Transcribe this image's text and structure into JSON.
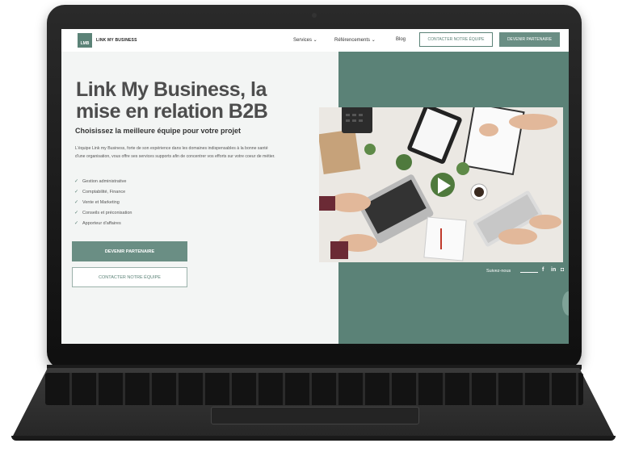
{
  "header": {
    "logo_text": "LMB",
    "brand": "LINK MY BUSINESS",
    "nav": [
      {
        "label": "Services ⌄"
      },
      {
        "label": "Référencements ⌄"
      },
      {
        "label": "Blog"
      }
    ],
    "contact_button": "CONTACTER NOTRE ÉQUIPE",
    "partner_button": "DEVENIR PARTENAIRE"
  },
  "hero": {
    "title": "Link My Business, la mise en relation B2B",
    "subtitle": "Choisissez la meilleure équipe pour votre projet",
    "description": "L'équipe Link my Business, forte de son expérience dans les domaines indispensables à la bonne santé d'une organisation, vous offre ses services supports afin de concentrer vos efforts sur votre coeur de métier.",
    "features": [
      "Gestion administrative",
      "Comptabilité, Finance",
      "Vente et Marketing",
      "Conseils et préconisation",
      "Apporteur d'affaires"
    ],
    "partner_button": "DEVENIR PARTENAIRE",
    "contact_button": "CONTACTER NOTRE ÉQUIPE"
  },
  "follow": {
    "label": "Suivez-nous",
    "icons": [
      "facebook-icon",
      "linkedin-icon",
      "instagram-icon"
    ]
  },
  "colors": {
    "accent": "#5b8277",
    "accent_light": "#6a8e84",
    "page_bg": "#f3f5f4"
  }
}
